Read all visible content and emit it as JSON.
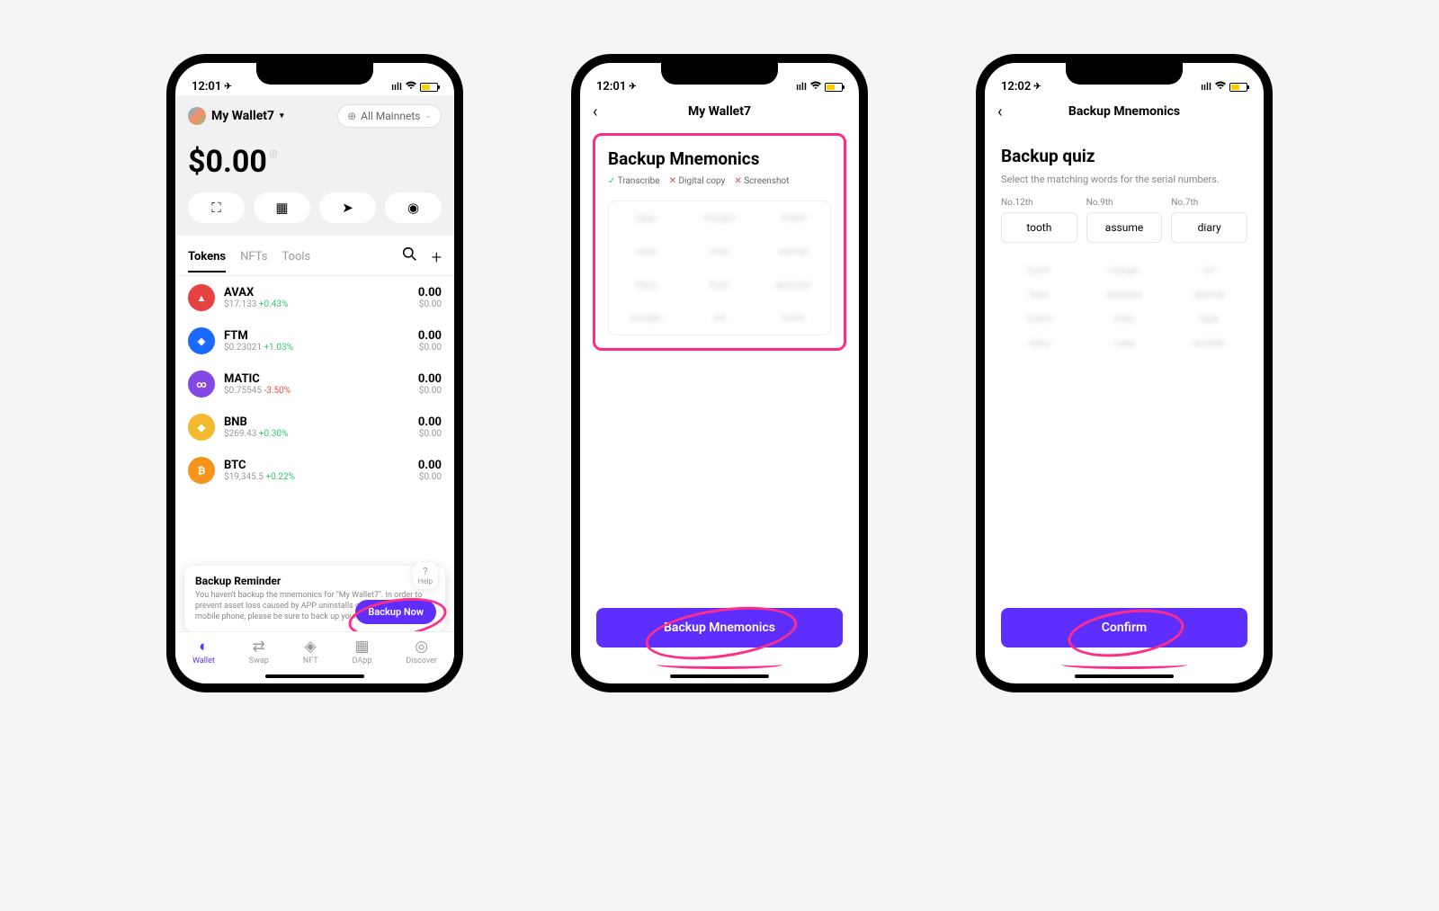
{
  "status": {
    "time1": "12:01",
    "time2": "12:01",
    "time3": "12:02",
    "nav": "✈"
  },
  "screen1": {
    "wallet_name": "My Wallet7",
    "network": "All Mainnets",
    "balance": "$0.00",
    "actions": {
      "scan": "⛶",
      "qr": "▦",
      "send": "➤",
      "buy": "◉"
    },
    "tabs": {
      "tokens": "Tokens",
      "nfts": "NFTs",
      "tools": "Tools"
    },
    "search_icon": "🔍",
    "add_icon": "+",
    "tokens": [
      {
        "sym": "AVAX",
        "price": "$17.133",
        "change": "+0.43%",
        "up": true,
        "amt": "0.00",
        "val": "$0.00",
        "color": "#e84142",
        "glyph": "▲"
      },
      {
        "sym": "FTM",
        "price": "$0.23021",
        "change": "+1.03%",
        "up": true,
        "amt": "0.00",
        "val": "$0.00",
        "color": "#1969ff",
        "glyph": "◈"
      },
      {
        "sym": "MATIC",
        "price": "$0.75545",
        "change": "-3.50%",
        "up": false,
        "amt": "0.00",
        "val": "$0.00",
        "color": "#8247e5",
        "glyph": "∞"
      },
      {
        "sym": "BNB",
        "price": "$269.43",
        "change": "+0.30%",
        "up": true,
        "amt": "0.00",
        "val": "$0.00",
        "color": "#f3ba2f",
        "glyph": "◆"
      },
      {
        "sym": "BTC",
        "price": "$19,345.5",
        "change": "+0.22%",
        "up": true,
        "amt": "0.00",
        "val": "$0.00",
        "color": "#f7931a",
        "glyph": "₿"
      }
    ],
    "reminder": {
      "title": "Backup Reminder",
      "text": "You haven't backup the mnemonics for \"My Wallet7\". In order to prevent asset loss caused by APP uninstalls or losing of the mobile phone, please be sure to back up your mnemonics!",
      "button": "Backup Now",
      "help": "Help"
    },
    "nav": [
      {
        "label": "Wallet",
        "icon": "◐",
        "active": true
      },
      {
        "label": "Swap",
        "icon": "⇄",
        "active": false
      },
      {
        "label": "NFT",
        "icon": "◈",
        "active": false
      },
      {
        "label": "DApp",
        "icon": "▦",
        "active": false
      },
      {
        "label": "Discover",
        "icon": "◎",
        "active": false
      }
    ]
  },
  "screen2": {
    "nav_title": "My Wallet7",
    "title": "Backup Mnemonics",
    "rules": [
      {
        "ok": true,
        "label": "Transcribe"
      },
      {
        "ok": false,
        "label": "Digital copy"
      },
      {
        "ok": false,
        "label": "Screenshot"
      }
    ],
    "words": [
      "tape",
      "margin",
      "infant",
      "case",
      "critic",
      "animal",
      "diary",
      "bust",
      "assume",
      "wonder",
      "art",
      "tooth"
    ],
    "button": "Backup Mnemonics"
  },
  "screen3": {
    "nav_title": "Backup Mnemonics",
    "title": "Backup quiz",
    "subtitle": "Select the matching words for the serial numbers.",
    "slots": [
      {
        "label": "No.12th",
        "word": "tooth"
      },
      {
        "label": "No.9th",
        "word": "assume"
      },
      {
        "label": "No.7th",
        "word": "diary"
      }
    ],
    "words": [
      "tooth",
      "margin",
      "art",
      "bust",
      "assume",
      "animal",
      "infant",
      "critic",
      "tape",
      "diary",
      "case",
      "wonder"
    ],
    "button": "Confirm"
  }
}
